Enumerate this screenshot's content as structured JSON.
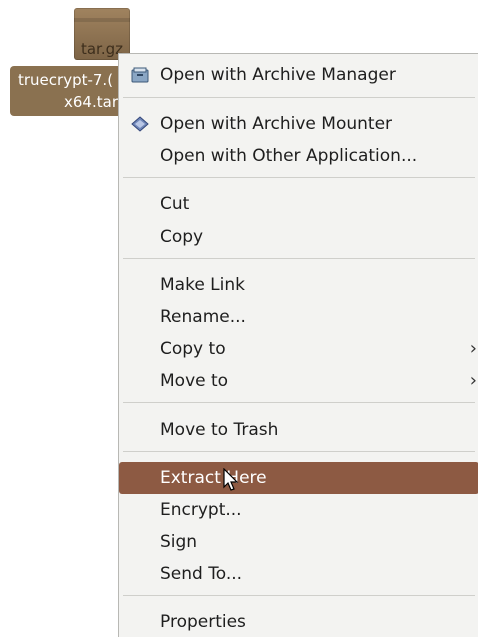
{
  "file": {
    "icon_text": "tar.gz",
    "label_line1": "truecrypt-7.(",
    "label_line2": "x64.tar"
  },
  "menu": {
    "items": [
      {
        "label": "Open with Archive Manager",
        "accel": "O",
        "icon": "archive-manager-icon"
      },
      {
        "label": "Open with Archive Mounter",
        "accel": "",
        "icon": "archive-mounter-icon"
      },
      {
        "label": "Open with Other Application...",
        "accel": "A"
      },
      {
        "label": "Cut",
        "accel": "t"
      },
      {
        "label": "Copy",
        "accel": "C"
      },
      {
        "label": "Make Link",
        "accel": "k"
      },
      {
        "label": "Rename...",
        "accel": "R"
      },
      {
        "label": "Copy to",
        "submenu": true
      },
      {
        "label": "Move to",
        "submenu": true
      },
      {
        "label": "Move to Trash",
        "accel": "v"
      },
      {
        "label": "Extract Here",
        "highlighted": true
      },
      {
        "label": "Encrypt..."
      },
      {
        "label": "Sign"
      },
      {
        "label": "Send To..."
      },
      {
        "label": "Properties",
        "accel": "P"
      }
    ],
    "submenu_arrow": "›"
  },
  "colors": {
    "menu_bg": "#f3f3f1",
    "highlight": "#8d5a43",
    "file_label_bg": "#8a7150"
  }
}
